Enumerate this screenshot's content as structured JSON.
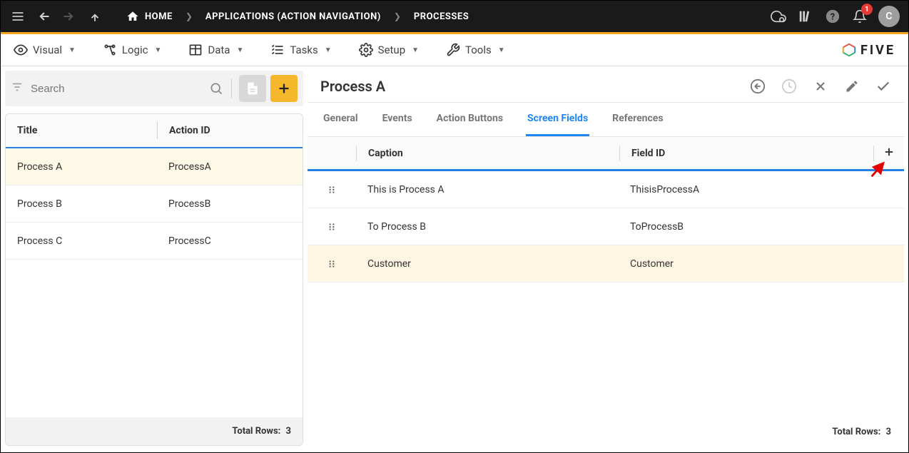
{
  "topbar": {
    "breadcrumbs": [
      {
        "label": "HOME",
        "icon": "home"
      },
      {
        "label": "APPLICATIONS (ACTION NAVIGATION)"
      },
      {
        "label": "PROCESSES"
      }
    ],
    "notification_count": "1",
    "avatar_letter": "C"
  },
  "menubar": {
    "items": [
      {
        "label": "Visual"
      },
      {
        "label": "Logic"
      },
      {
        "label": "Data"
      },
      {
        "label": "Tasks"
      },
      {
        "label": "Setup"
      },
      {
        "label": "Tools"
      }
    ],
    "logo_text": "FIVE"
  },
  "search": {
    "placeholder": "Search",
    "value": ""
  },
  "list": {
    "columns": {
      "title": "Title",
      "action_id": "Action ID"
    },
    "rows": [
      {
        "title": "Process A",
        "action_id": "ProcessA",
        "selected": true
      },
      {
        "title": "Process B",
        "action_id": "ProcessB",
        "selected": false
      },
      {
        "title": "Process C",
        "action_id": "ProcessC",
        "selected": false
      }
    ],
    "footer_label": "Total Rows:",
    "footer_count": "3"
  },
  "detail": {
    "title": "Process A",
    "tabs": [
      {
        "label": "General",
        "active": false
      },
      {
        "label": "Events",
        "active": false
      },
      {
        "label": "Action Buttons",
        "active": false
      },
      {
        "label": "Screen Fields",
        "active": true
      },
      {
        "label": "References",
        "active": false
      }
    ],
    "field_columns": {
      "caption": "Caption",
      "field_id": "Field ID"
    },
    "field_rows": [
      {
        "caption": "This is Process A",
        "field_id": "ThisisProcessA",
        "hl": false
      },
      {
        "caption": "To Process B",
        "field_id": "ToProcessB",
        "hl": false
      },
      {
        "caption": "Customer",
        "field_id": "Customer",
        "hl": true
      }
    ],
    "footer_label": "Total Rows:",
    "footer_count": "3"
  }
}
